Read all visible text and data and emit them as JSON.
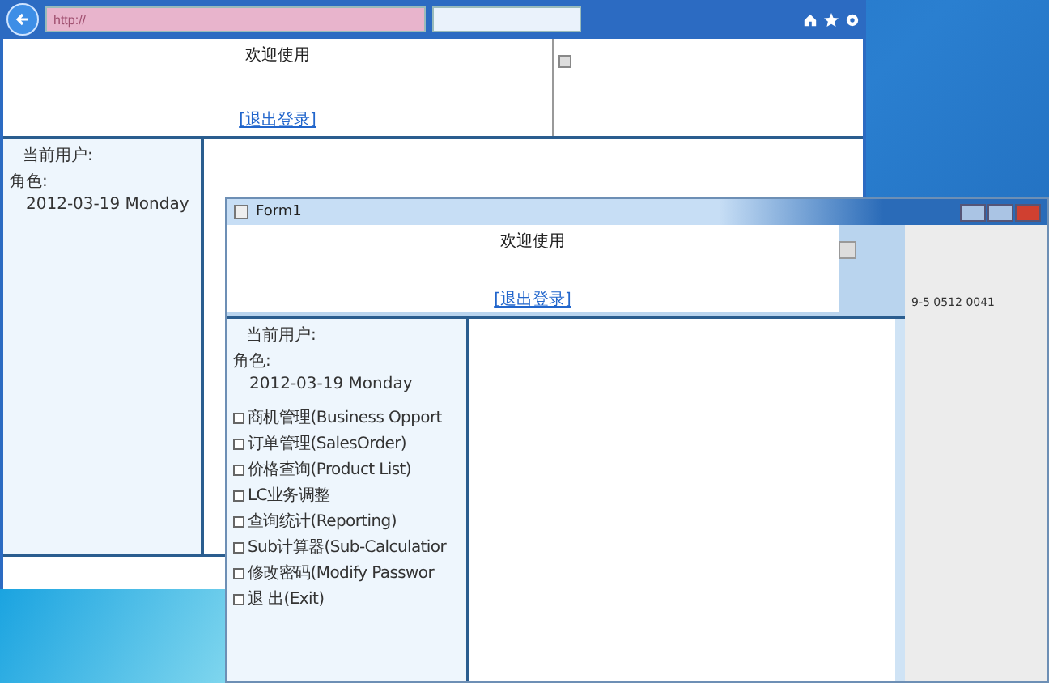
{
  "browser": {
    "address": "http://",
    "header": {
      "title": "欢迎使用",
      "link": "[退出登录]"
    },
    "user": {
      "user_label": "当前用户:",
      "role_label": "角色:",
      "date": "2012-03-19 Monday"
    }
  },
  "form": {
    "title": "Form1",
    "header": {
      "title": "欢迎使用",
      "link": "[退出登录]"
    },
    "user": {
      "user_label": "当前用户:",
      "role_label": "角色:",
      "date": "2012-03-19 Monday"
    },
    "menu": [
      {
        "label": "商机管理(Business Opport"
      },
      {
        "label": "订单管理(SalesOrder)"
      },
      {
        "label": "价格查询(Product List)"
      },
      {
        "label": "LC业务调整"
      },
      {
        "label": "查询统计(Reporting)"
      },
      {
        "label": "Sub计算器(Sub-Calculatior"
      },
      {
        "label": "修改密码(Modify Passwor"
      },
      {
        "label": "退 出(Exit)"
      }
    ],
    "side_text": "9-5 0512 0041"
  }
}
